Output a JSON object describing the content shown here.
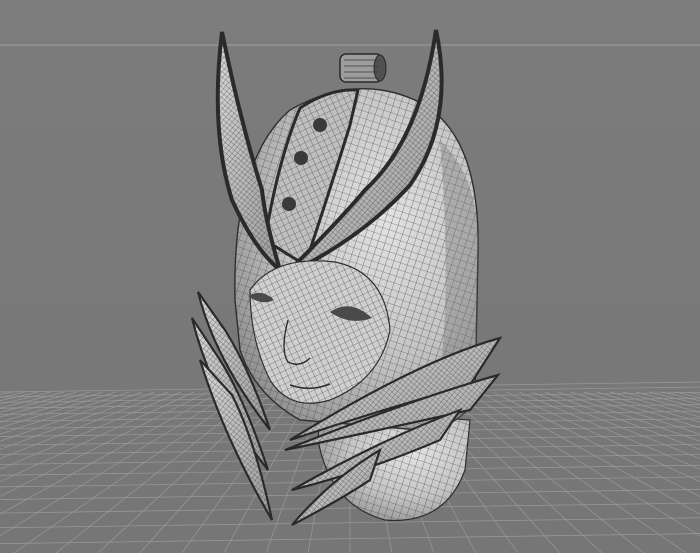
{
  "viewport": {
    "model": "helmet-wireframe",
    "colors": {
      "background": "#7a7a7a",
      "grid": "#9a9a9a",
      "grid_horizon": "#a3a3a3",
      "mesh_fill_light": "#d6d6d6",
      "mesh_fill_dark": "#8e8e8e",
      "wire": "#3c3c3c",
      "outline": "#2e2e2e"
    }
  }
}
